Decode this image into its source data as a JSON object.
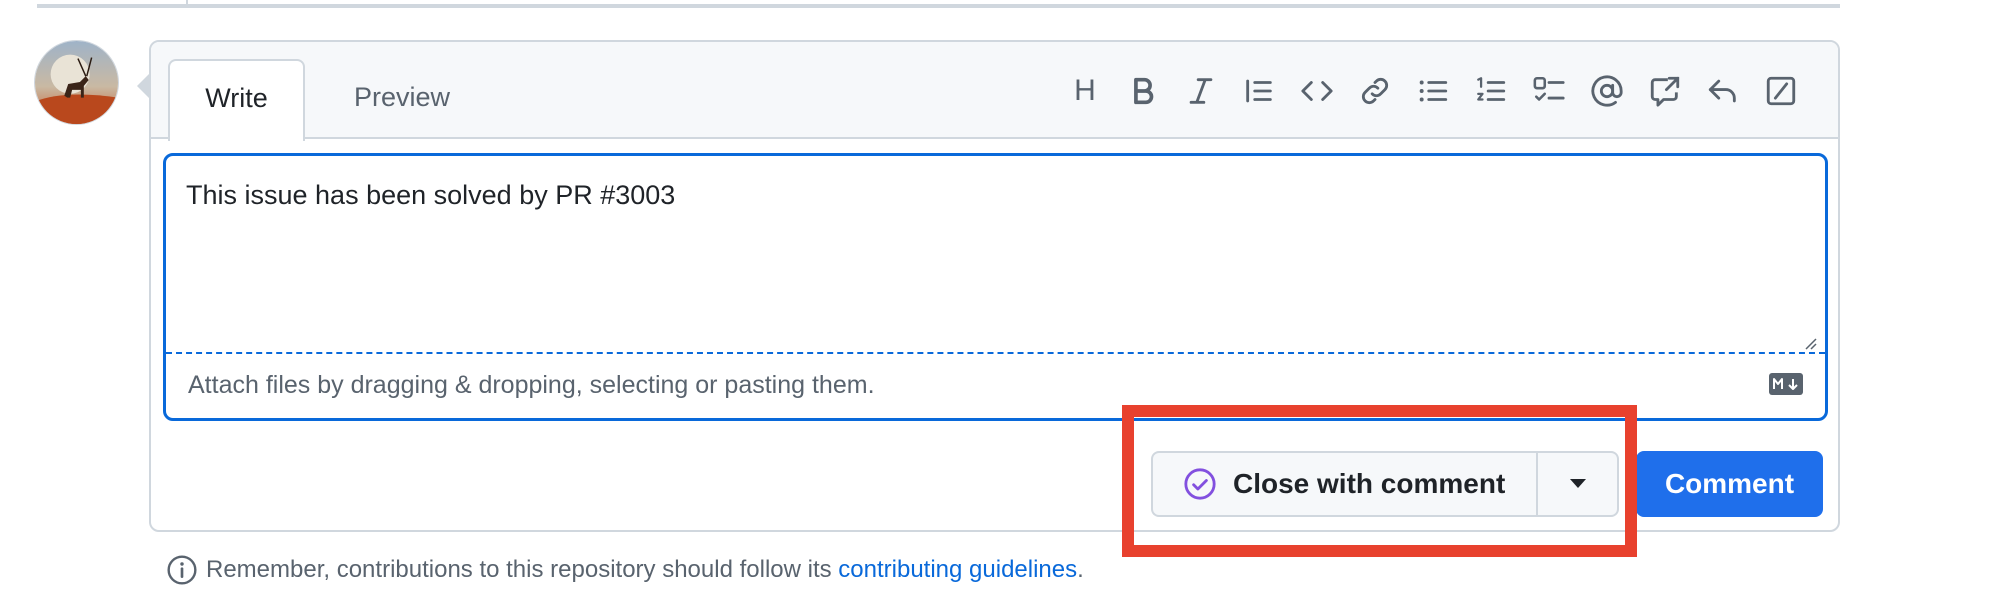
{
  "editor": {
    "tabs": [
      {
        "label": "Write",
        "active": true
      },
      {
        "label": "Preview",
        "active": false
      }
    ],
    "toolbar": [
      {
        "icon": "heading-icon",
        "text": "H"
      },
      {
        "icon": "bold-icon"
      },
      {
        "icon": "italic-icon"
      },
      {
        "icon": "quote-icon"
      },
      {
        "icon": "code-icon"
      },
      {
        "icon": "link-icon"
      },
      {
        "icon": "unordered-list-icon"
      },
      {
        "icon": "ordered-list-icon"
      },
      {
        "icon": "task-list-icon"
      },
      {
        "icon": "mention-icon"
      },
      {
        "icon": "cross-reference-icon"
      },
      {
        "icon": "reply-icon"
      },
      {
        "icon": "slash-commands-icon"
      }
    ],
    "body_text": "This issue has been solved by PR #3003",
    "attach_hint": "Attach files by dragging & dropping, selecting or pasting them.",
    "markdown_icon": "markdown-icon"
  },
  "actions": {
    "close_label": "Close with comment",
    "close_icon": "check-circle-icon",
    "dropdown_icon": "triangle-down-icon",
    "comment_label": "Comment"
  },
  "footer": {
    "prefix": "Remember, contributions to this repository should follow its ",
    "link": "contributing guidelines",
    "suffix": "."
  },
  "colors": {
    "accent": "#0969da",
    "primary_button": "#1f6feb",
    "highlight": "#e8412e",
    "close_icon": "#8250df"
  }
}
